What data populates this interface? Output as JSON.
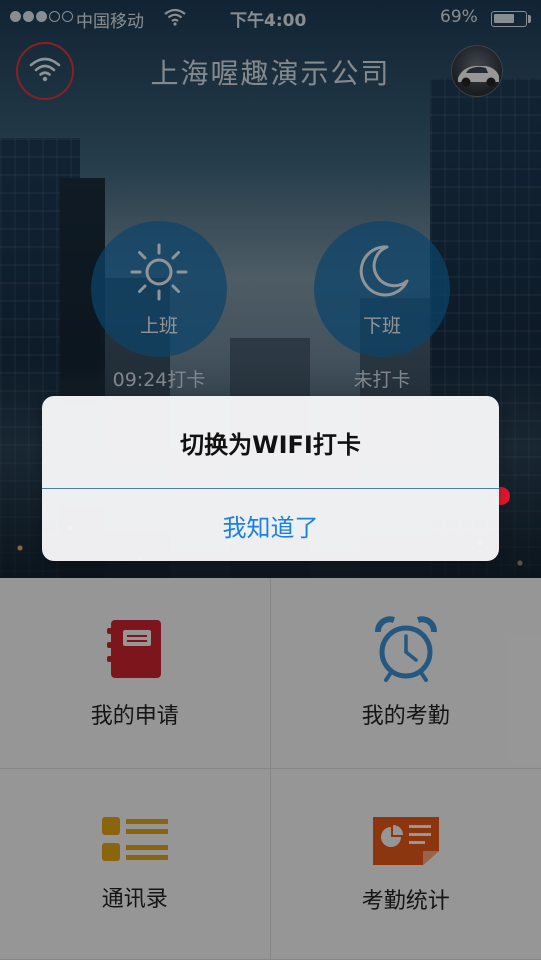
{
  "status_bar": {
    "carrier": "中国移动",
    "time": "下午4:00",
    "battery": "69%",
    "battery_level": 0.69,
    "signal_bars": 3,
    "signal_total": 5
  },
  "nav": {
    "title": "上海喔趣演示公司",
    "wifi_icon": "wifi-icon",
    "avatar_icon": "car-avatar"
  },
  "clock": {
    "in": {
      "label": "上班",
      "status": "09:24打卡",
      "icon": "sun-icon"
    },
    "out": {
      "label": "下班",
      "status": "未打卡",
      "icon": "moon-icon"
    }
  },
  "menu": [
    {
      "label": "我的申请",
      "icon": "notebook-icon",
      "color": "#c8242e"
    },
    {
      "label": "我的考勤",
      "icon": "alarm-clock-icon",
      "color": "#3a8fd0"
    },
    {
      "label": "通讯录",
      "icon": "list-icon",
      "color": "#e0a416"
    },
    {
      "label": "考勤统计",
      "icon": "report-icon",
      "color": "#e2571a"
    }
  ],
  "alert": {
    "message": "切换为WIFI打卡",
    "button": "我知道了"
  },
  "colors": {
    "accent_blue": "#1a7fe6",
    "clock_button": "#146eaa",
    "wifi_ring": "#e0323a"
  }
}
